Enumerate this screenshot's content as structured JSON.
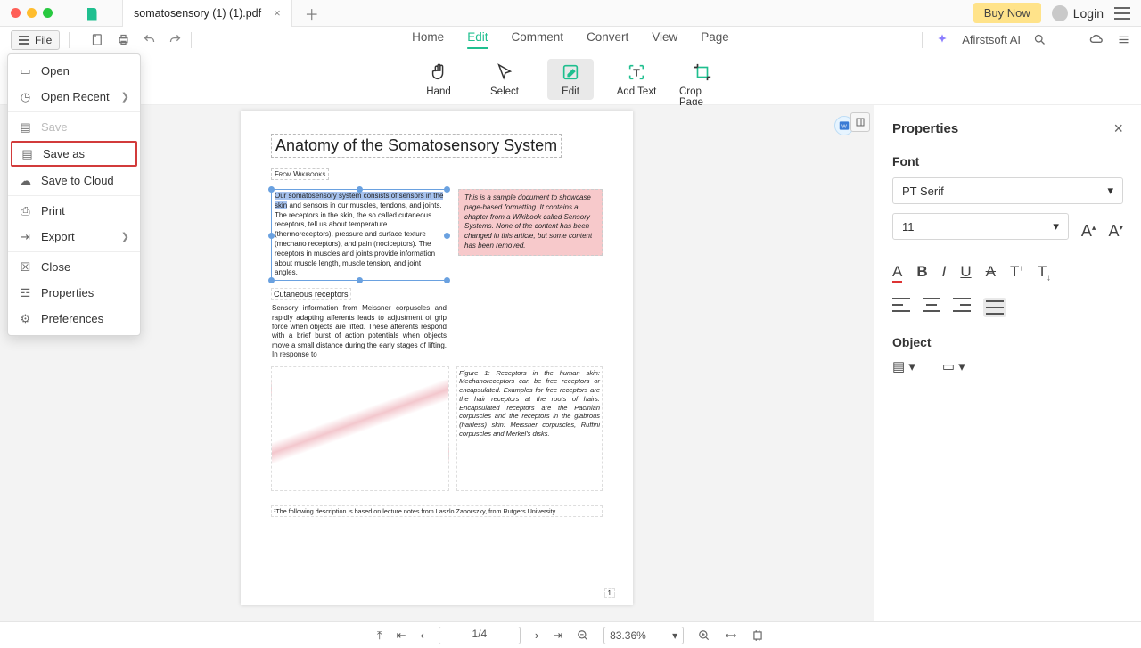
{
  "titlebar": {
    "tab_title": "somatosensory (1) (1).pdf",
    "buy_now": "Buy Now",
    "login": "Login"
  },
  "toolbar1": {
    "file_label": "File",
    "menu": {
      "home": "Home",
      "edit": "Edit",
      "comment": "Comment",
      "convert": "Convert",
      "view": "View",
      "page": "Page"
    },
    "ai_label": "Afirstsoft AI"
  },
  "tools": {
    "hand": "Hand",
    "select": "Select",
    "edit": "Edit",
    "addtext": "Add Text",
    "crop": "Crop Page"
  },
  "file_menu": {
    "open": "Open",
    "recent": "Open Recent",
    "save": "Save",
    "saveas": "Save as",
    "cloud": "Save to Cloud",
    "print": "Print",
    "export": "Export",
    "close": "Close",
    "properties": "Properties",
    "preferences": "Preferences"
  },
  "doc": {
    "title": "Anatomy of the Somatosensory System",
    "source": "From Wikibooks",
    "selected_text_hl": "Our somatosensory system consists of sensors in the skin",
    "selected_text_rest": " and sensors in our muscles, tendons, and joints. The receptors in the skin, the so called cutaneous receptors, tell us about temperature (thermoreceptors), pressure and surface texture (mechano receptors), and pain (nociceptors). The receptors in muscles and joints provide information about muscle length, muscle tension, and joint angles.",
    "note": "This is a sample document to showcase page-based formatting. It contains a chapter from a Wikibook called Sensory Systems. None of the content has been changed in this article, but some content has been removed.",
    "subhead": "Cutaneous receptors",
    "para1": "Sensory information from Meissner corpuscles and rapidly adapting afferents leads to adjustment of grip force when objects are lifted. These afferents respond with a brief burst of action potentials when objects move a small distance during the early stages of lifting. In response to",
    "figcap": "Figure 1: Receptors in the human skin: Mechanoreceptors can be free receptors or encapsulated. Examples for free receptors are the hair receptors at the roots of hairs. Encapsulated receptors are the Pacinian corpuscles and the receptors in the glabrous (hairless) skin: Meissner corpuscles, Ruffini corpuscles and Merkel's disks.",
    "footnote": "¹The following description is based on lecture notes from Laszlo Zaborszky, from Rutgers University.",
    "page_number": "1"
  },
  "props": {
    "title": "Properties",
    "font_label": "Font",
    "font_family": "PT Serif",
    "font_size": "11",
    "object_label": "Object"
  },
  "status": {
    "page": "1/4",
    "zoom": "83.36%"
  }
}
